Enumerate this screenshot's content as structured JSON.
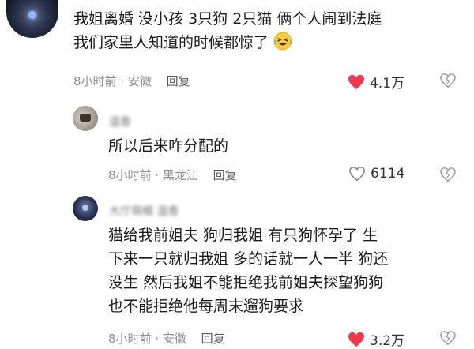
{
  "comments": [
    {
      "text_line1": "我姐离婚  没小孩 3只狗 2只猫  俩个人闹到法庭",
      "text_line2": "我们家里人知道的时候都惊了",
      "emoji": "laughing-crying-emoji",
      "time": "8小时前",
      "location": "安徽",
      "reply_label": "回复",
      "likes": "4.1万",
      "liked": true
    },
    {
      "username": "温香",
      "text": "所以后来咋分配的",
      "time": "8小时前",
      "location": "黑龙江",
      "reply_label": "回复",
      "likes": "6114",
      "liked": false
    },
    {
      "username": "大厅萌橘  温香",
      "text_line1": "猫给我前姐夫  狗归我姐  有只狗怀孕了  生",
      "text_line2": "下来一只就归我姐  多的话就一人一半  狗还",
      "text_line3": "没生  然后我姐不能拒绝我前姐夫探望狗狗",
      "text_line4": "也不能拒绝他每周末遛狗要求",
      "time": "8小时前",
      "location": "安徽",
      "reply_label": "回复",
      "likes": "3.2万",
      "liked": true
    }
  ],
  "colors": {
    "liked_heart": "#f0384f",
    "meta_gray": "#8e8e8e"
  },
  "separator": " · "
}
